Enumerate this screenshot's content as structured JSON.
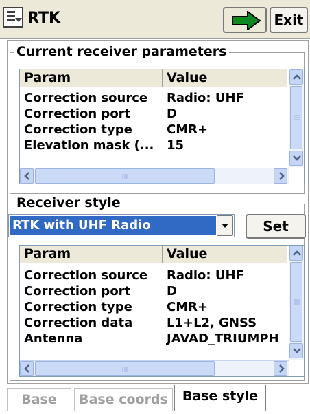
{
  "app": {
    "title": "RTK",
    "exit_label": "Exit"
  },
  "current_params": {
    "legend": "Current receiver parameters",
    "headers": [
      "Param",
      "Value"
    ],
    "rows": [
      {
        "param": "Correction source",
        "value": "Radio: UHF"
      },
      {
        "param": "Correction port",
        "value": "D"
      },
      {
        "param": "Correction type",
        "value": "CMR+"
      },
      {
        "param": "Elevation mask (...",
        "value": "15"
      }
    ]
  },
  "receiver_style": {
    "legend": "Receiver style",
    "selected": "RTK with UHF Radio",
    "set_label": "Set",
    "headers": [
      "Param",
      "Value"
    ],
    "rows": [
      {
        "param": "Correction source",
        "value": "Radio: UHF"
      },
      {
        "param": "Correction port",
        "value": "D"
      },
      {
        "param": "Correction type",
        "value": "CMR+"
      },
      {
        "param": "Correction data",
        "value": "L1+L2, GNSS"
      },
      {
        "param": "Antenna",
        "value": "JAVAD_TRIUMPH"
      }
    ]
  },
  "tabs": [
    {
      "label": "Base",
      "active": false
    },
    {
      "label": "Base coords",
      "active": false
    },
    {
      "label": "Base style",
      "active": true
    }
  ]
}
